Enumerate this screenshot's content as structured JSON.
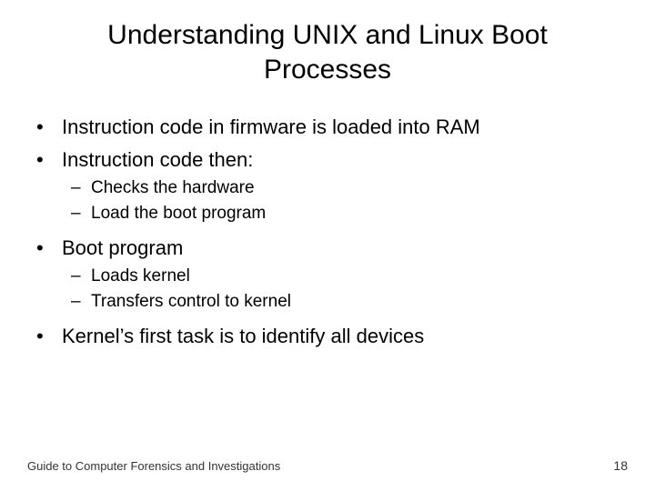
{
  "title": "Understanding UNIX and Linux Boot Processes",
  "bullets": {
    "b1": "Instruction code in firmware is loaded into RAM",
    "b2": "Instruction code then:",
    "b2s1": "Checks the hardware",
    "b2s2": "Load the boot program",
    "b3": "Boot program",
    "b3s1": "Loads kernel",
    "b3s2": "Transfers control to kernel",
    "b4": "Kernel’s first task is to identify all devices"
  },
  "footer": {
    "source": "Guide to Computer Forensics and Investigations",
    "page": "18"
  }
}
